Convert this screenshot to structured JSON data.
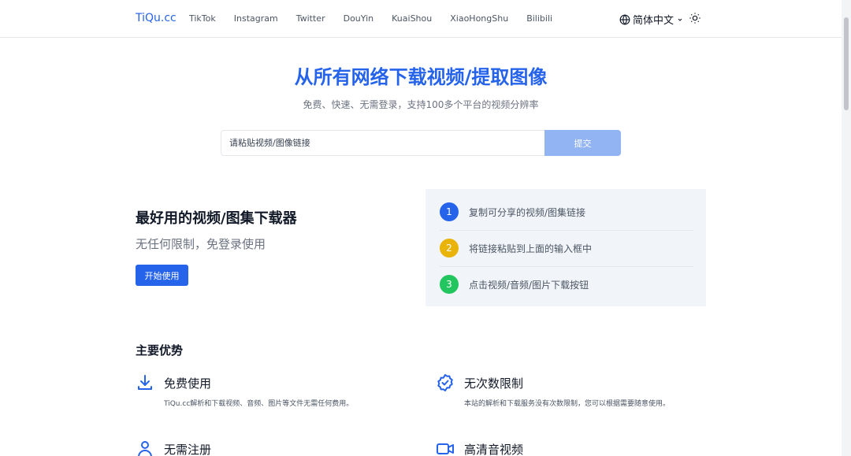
{
  "nav": {
    "logo": "TiQu.cc",
    "links": [
      "TikTok",
      "Instagram",
      "Twitter",
      "DouYin",
      "KuaiShou",
      "XiaoHongShu",
      "Bilibili"
    ],
    "language": "简体中文",
    "icons": [
      "globe-icon",
      "chevron-down-icon",
      "sun-icon"
    ]
  },
  "hero": {
    "title": "从所有网络下载视频/提取图像",
    "subtitle": "免费、快速、无需登录，支持100多个平台的视频分辨率"
  },
  "search": {
    "placeholder": "请粘贴视频/图像链接",
    "value": "",
    "submit_label": "提交"
  },
  "intro": {
    "title": "最好用的视频/图集下载器",
    "subtitle": "无任何限制，免登录使用",
    "cta_label": "开始使用"
  },
  "steps": [
    {
      "number": "1",
      "text": "复制可分享的视频/图集链接",
      "color": "#2563eb"
    },
    {
      "number": "2",
      "text": "将链接粘贴到上面的输入框中",
      "color": "#eab308"
    },
    {
      "number": "3",
      "text": "点击视频/音频/图片下载按钮",
      "color": "#22c55e"
    }
  ],
  "advantages": {
    "heading": "主要优势",
    "items": [
      {
        "icon": "download-icon",
        "title": "免费使用",
        "desc": "TiQu.cc解析和下载视频、音频、图片等文件无需任何费用。"
      },
      {
        "icon": "badge-check-icon",
        "title": "无次数限制",
        "desc": "本站的解析和下载服务没有次数限制，您可以根据需要随意使用。"
      },
      {
        "icon": "user-icon",
        "title": "无需注册",
        "desc": ""
      },
      {
        "icon": "video-camera-icon",
        "title": "高清音视频",
        "desc": ""
      }
    ]
  },
  "colors": {
    "accent": "#2563eb",
    "submit_disabled": "#93b4f3",
    "panel_bg": "#f1f4f8"
  }
}
